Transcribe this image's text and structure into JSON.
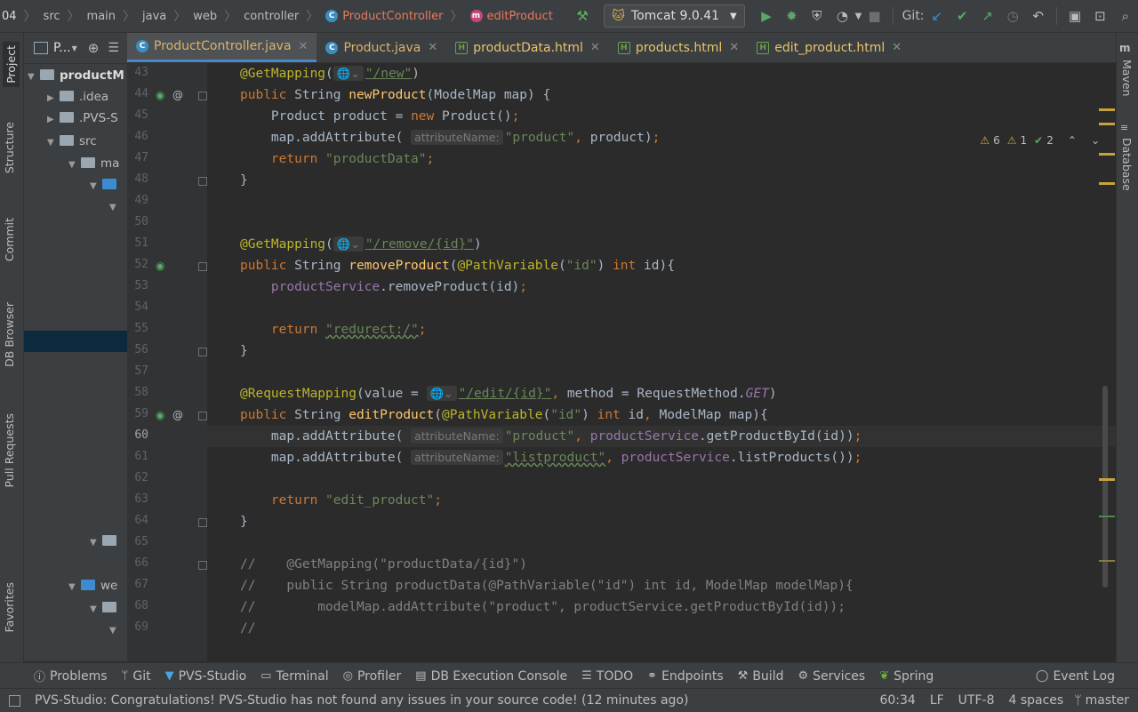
{
  "breadcrumb": {
    "root": "04",
    "items": [
      "src",
      "main",
      "java",
      "web",
      "controller"
    ],
    "class_name": "ProductController",
    "method_name": "editProduct"
  },
  "run_config": {
    "label": "Tomcat 9.0.41"
  },
  "git": {
    "label": "Git:"
  },
  "left_tools": {
    "project": "Project",
    "structure": "Structure",
    "commit": "Commit",
    "db_browser": "DB Browser",
    "pull_requests": "Pull Requests",
    "favorites": "Favorites"
  },
  "right_tools": {
    "maven": "Maven",
    "database": "Database"
  },
  "project_panel": {
    "title": "P...",
    "tree": [
      {
        "label": "productM",
        "level": 0,
        "arrow": "down"
      },
      {
        "label": ".idea",
        "level": 1,
        "arrow": "right"
      },
      {
        "label": ".PVS-S",
        "level": 1,
        "arrow": "right"
      },
      {
        "label": "src",
        "level": 1,
        "arrow": "down"
      },
      {
        "label": "ma",
        "level": 2,
        "arrow": "down"
      },
      {
        "label": "",
        "level": 3,
        "arrow": "down"
      },
      {
        "label": "",
        "level": 4,
        "arrow": "down"
      },
      {
        "label": "",
        "level": 3,
        "arrow": "down"
      },
      {
        "label": "we",
        "level": 2,
        "arrow": "down"
      },
      {
        "label": "",
        "level": 3,
        "arrow": "down"
      },
      {
        "label": "",
        "level": 4,
        "arrow": "down"
      }
    ]
  },
  "tabs": [
    {
      "label": "ProductController.java",
      "type": "java",
      "active": true
    },
    {
      "label": "Product.java",
      "type": "java",
      "active": false
    },
    {
      "label": "productData.html",
      "type": "html",
      "active": false
    },
    {
      "label": "products.html",
      "type": "html",
      "active": false
    },
    {
      "label": "edit_product.html",
      "type": "html",
      "active": false
    }
  ],
  "inspections": {
    "warnings": "6",
    "weak_warnings": "1",
    "typos": "2"
  },
  "editor": {
    "current_line": 60,
    "lines": [
      {
        "n": 43,
        "tokens": [
          [
            "ann",
            "@GetMapping"
          ],
          [
            "",
            "("
          ],
          [
            "hint",
            "🌐⌄"
          ],
          [
            "str-u",
            "\"/new\""
          ],
          [
            "",
            ")"
          ]
        ]
      },
      {
        "n": 44,
        "tokens": [
          [
            "kw",
            "public "
          ],
          [
            "",
            "String "
          ],
          [
            "fn",
            "newProduct"
          ],
          [
            "",
            "(ModelMap map) {"
          ]
        ]
      },
      {
        "n": 45,
        "tokens": [
          [
            "",
            "    Product product = "
          ],
          [
            "kw",
            "new "
          ],
          [
            "",
            "Product()"
          ],
          [
            "kw",
            ";"
          ]
        ]
      },
      {
        "n": 46,
        "tokens": [
          [
            "",
            "    map.addAttribute( "
          ],
          [
            "hint",
            "attributeName:"
          ],
          [
            "str",
            "\"product\""
          ],
          [
            "kw",
            ", "
          ],
          [
            "",
            "product)"
          ],
          [
            "kw",
            ";"
          ]
        ]
      },
      {
        "n": 47,
        "tokens": [
          [
            "",
            "    "
          ],
          [
            "kw",
            "return "
          ],
          [
            "str",
            "\"productData\""
          ],
          [
            "kw",
            ";"
          ]
        ]
      },
      {
        "n": 48,
        "tokens": [
          [
            "",
            "}"
          ]
        ]
      },
      {
        "n": 49,
        "tokens": []
      },
      {
        "n": 50,
        "tokens": []
      },
      {
        "n": 51,
        "tokens": [
          [
            "ann",
            "@GetMapping"
          ],
          [
            "",
            "("
          ],
          [
            "hint",
            "🌐⌄"
          ],
          [
            "str-u",
            "\"/remove/{id}\""
          ],
          [
            "",
            ")"
          ]
        ]
      },
      {
        "n": 52,
        "tokens": [
          [
            "kw",
            "public "
          ],
          [
            "",
            "String "
          ],
          [
            "fn",
            "removeProduct"
          ],
          [
            "",
            "("
          ],
          [
            "ann",
            "@PathVariable"
          ],
          [
            "",
            "("
          ],
          [
            "str",
            "\"id\""
          ],
          [
            "",
            ") "
          ],
          [
            "kw",
            "int "
          ],
          [
            "",
            "id){"
          ]
        ]
      },
      {
        "n": 53,
        "tokens": [
          [
            "fld",
            "    productService"
          ],
          [
            "",
            ".removeProduct(id)"
          ],
          [
            "kw",
            ";"
          ]
        ]
      },
      {
        "n": 54,
        "tokens": []
      },
      {
        "n": 55,
        "tokens": [
          [
            "",
            "    "
          ],
          [
            "kw",
            "return "
          ],
          [
            "str-w",
            "\"redurect:/\""
          ],
          [
            "kw",
            ";"
          ]
        ]
      },
      {
        "n": 56,
        "tokens": [
          [
            "",
            "}"
          ]
        ]
      },
      {
        "n": 57,
        "tokens": []
      },
      {
        "n": 58,
        "tokens": [
          [
            "ann",
            "@RequestMapping"
          ],
          [
            "",
            "(value = "
          ],
          [
            "hint",
            "🌐⌄"
          ],
          [
            "str-u",
            "\"/edit/{id}\""
          ],
          [
            "kw",
            ", "
          ],
          [
            "",
            "method = RequestMethod."
          ],
          [
            "fld-i",
            "GET"
          ],
          [
            "",
            ")"
          ]
        ]
      },
      {
        "n": 59,
        "tokens": [
          [
            "kw",
            "public "
          ],
          [
            "",
            "String "
          ],
          [
            "fn",
            "editProduct"
          ],
          [
            "",
            "("
          ],
          [
            "ann",
            "@PathVariable"
          ],
          [
            "",
            "("
          ],
          [
            "str",
            "\"id\""
          ],
          [
            "",
            ") "
          ],
          [
            "kw",
            "int "
          ],
          [
            "",
            "id"
          ],
          [
            "kw",
            ", "
          ],
          [
            "",
            "ModelMap map){"
          ]
        ]
      },
      {
        "n": 60,
        "tokens": [
          [
            "",
            "    map.addAttribute( "
          ],
          [
            "hint",
            "attributeName:"
          ],
          [
            "str",
            "\"product\""
          ],
          [
            "kw",
            ", "
          ],
          [
            "fld",
            "productService"
          ],
          [
            "",
            ".getProductById(id))"
          ],
          [
            "kw",
            ";"
          ]
        ]
      },
      {
        "n": 61,
        "tokens": [
          [
            "",
            "    map.addAttribute( "
          ],
          [
            "hint",
            "attributeName:"
          ],
          [
            "str-w",
            "\"listproduct\""
          ],
          [
            "kw",
            ", "
          ],
          [
            "fld",
            "productService"
          ],
          [
            "",
            ".listProducts())"
          ],
          [
            "kw",
            ";"
          ]
        ]
      },
      {
        "n": 62,
        "tokens": []
      },
      {
        "n": 63,
        "tokens": [
          [
            "",
            "    "
          ],
          [
            "kw",
            "return "
          ],
          [
            "str",
            "\"edit_product\""
          ],
          [
            "kw",
            ";"
          ]
        ]
      },
      {
        "n": 64,
        "tokens": [
          [
            "",
            "}"
          ]
        ]
      },
      {
        "n": 65,
        "tokens": []
      },
      {
        "n": 66,
        "tokens": [
          [
            "cmt",
            "//    @GetMapping(\"productData/{id}\")"
          ]
        ]
      },
      {
        "n": 67,
        "tokens": [
          [
            "cmt",
            "//    public String productData(@PathVariable(\"id\") int id, ModelMap modelMap){"
          ]
        ]
      },
      {
        "n": 68,
        "tokens": [
          [
            "cmt",
            "//        modelMap.addAttribute(\"product\", productService.getProductById(id));"
          ]
        ]
      },
      {
        "n": 69,
        "tokens": [
          [
            "cmt",
            "//"
          ]
        ]
      }
    ]
  },
  "bottom_tools": [
    {
      "label": "Problems",
      "icon": "problems-icon"
    },
    {
      "label": "Git",
      "icon": "git-icon"
    },
    {
      "label": "PVS-Studio",
      "icon": "pvs-icon"
    },
    {
      "label": "Terminal",
      "icon": "terminal-icon"
    },
    {
      "label": "Profiler",
      "icon": "profiler-icon"
    },
    {
      "label": "DB Execution Console",
      "icon": "db-console-icon"
    },
    {
      "label": "TODO",
      "icon": "todo-icon"
    },
    {
      "label": "Endpoints",
      "icon": "endpoints-icon"
    },
    {
      "label": "Build",
      "icon": "build-icon"
    },
    {
      "label": "Services",
      "icon": "services-icon"
    },
    {
      "label": "Spring",
      "icon": "spring-icon"
    },
    {
      "label": "Event Log",
      "icon": "event-log-icon"
    }
  ],
  "status": {
    "message": "PVS-Studio: Congratulations! PVS-Studio has not found any issues in your source code! (12 minutes ago)",
    "position": "60:34",
    "line_ending": "LF",
    "encoding": "UTF-8",
    "indent": "4 spaces",
    "branch": "master"
  }
}
